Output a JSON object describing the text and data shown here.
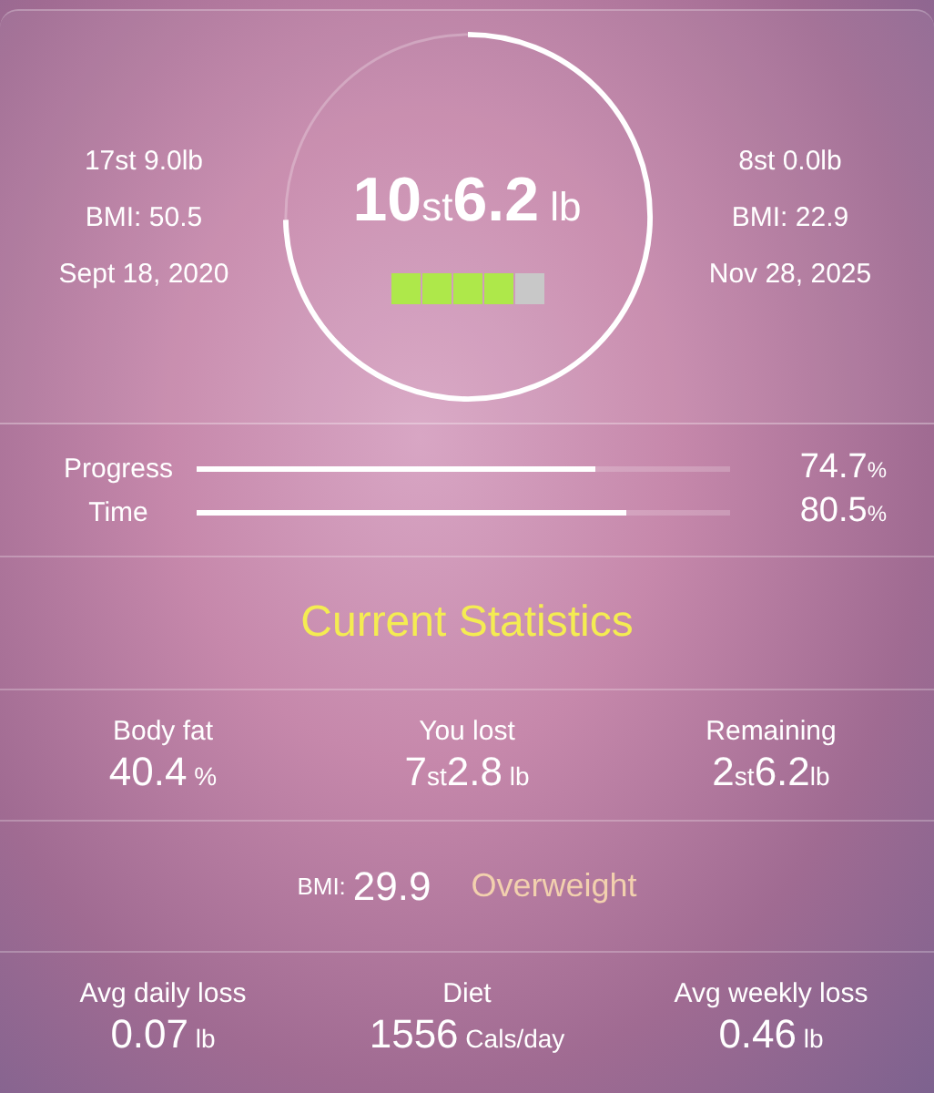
{
  "start": {
    "weight": "17st 9.0lb",
    "bmi": "BMI: 50.5",
    "date": "Sept 18, 2020"
  },
  "current": {
    "value": [
      {
        "num": "10",
        "unit": "st"
      },
      {
        "num": "6.2",
        "unit": " lb"
      }
    ],
    "ring": {
      "level": 0.747
    },
    "meter": {
      "level": 0.8
    }
  },
  "goal": {
    "weight": "8st 0.0lb",
    "bmi": "BMI: 22.9",
    "date": "Nov 28, 2025"
  },
  "bars": [
    {
      "label": "Progress",
      "level": 0.747,
      "value": [
        {
          "num": "74.7",
          "unit": "%"
        }
      ]
    },
    {
      "label": "Time",
      "level": 0.805,
      "value": [
        {
          "num": "80.5",
          "unit": "%"
        }
      ]
    }
  ],
  "section_title": "Current Statistics",
  "stats": [
    {
      "label": "Body fat",
      "value": [
        {
          "num": "40.4",
          "unit": " %"
        }
      ]
    },
    {
      "label": "You lost",
      "value": [
        {
          "num": "7",
          "unit": "st"
        },
        {
          "num": "2.8",
          "unit": " lb"
        }
      ]
    },
    {
      "label": "Remaining",
      "value": [
        {
          "num": "2",
          "unit": "st"
        },
        {
          "num": "6.2",
          "unit": "lb"
        }
      ]
    }
  ],
  "bmi": {
    "label": "BMI:",
    "value": "29.9",
    "category": "Overweight"
  },
  "averages": [
    {
      "label": "Avg daily loss",
      "value": [
        {
          "num": "0.07",
          "unit": " lb"
        }
      ]
    },
    {
      "label": "Diet",
      "value": [
        {
          "num": "1556",
          "unit": " Cals/day"
        }
      ]
    },
    {
      "label": "Avg weekly loss",
      "value": [
        {
          "num": "0.46",
          "unit": " lb"
        }
      ]
    }
  ]
}
